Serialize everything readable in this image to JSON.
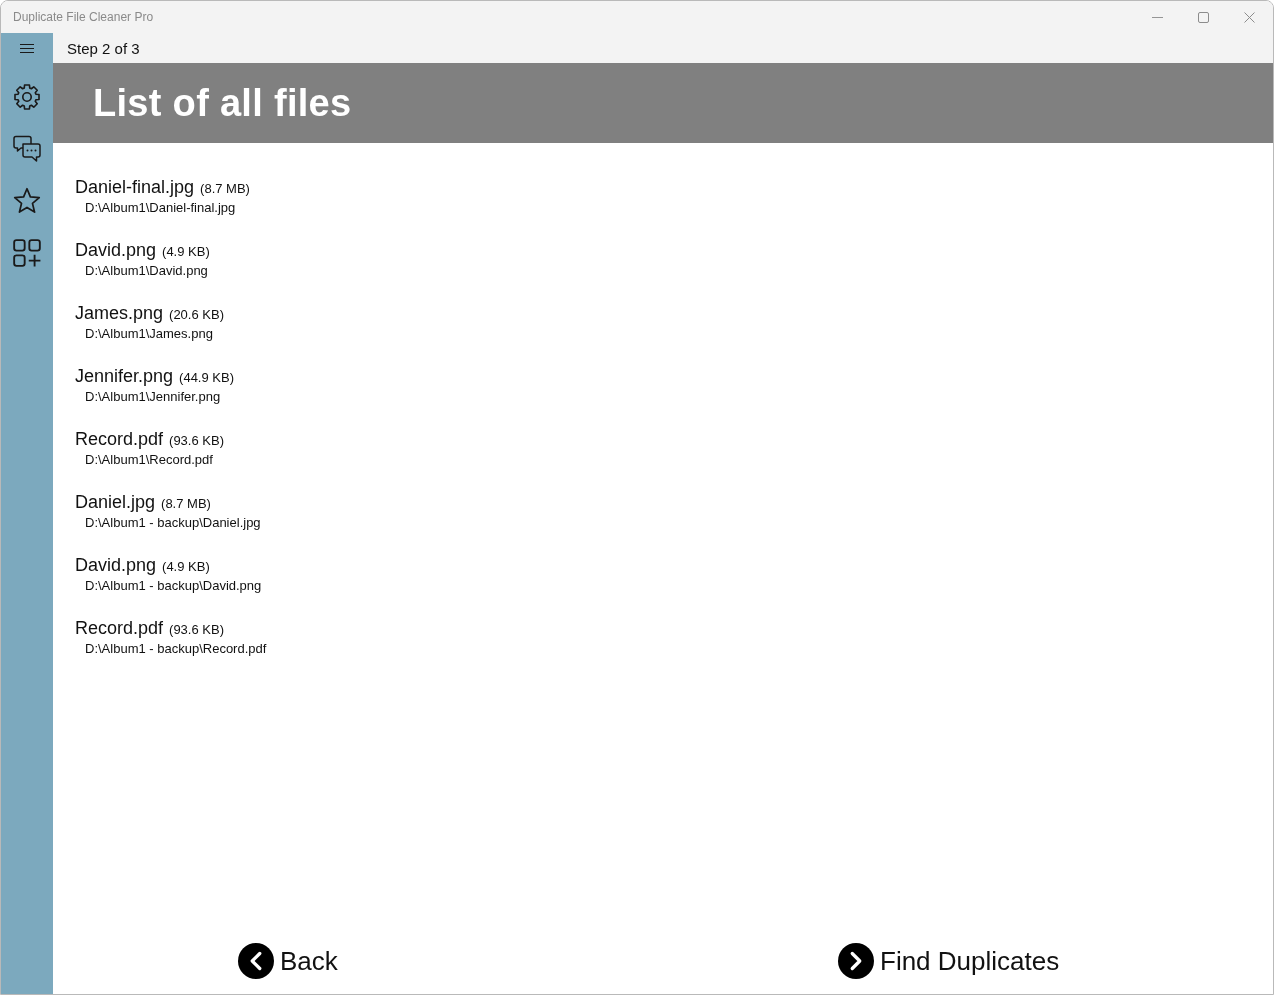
{
  "window": {
    "title": "Duplicate File Cleaner Pro"
  },
  "step": "Step 2 of 3",
  "header": {
    "title": "List of all files"
  },
  "files": [
    {
      "name": "Daniel-final.jpg",
      "size": "(8.7 MB)",
      "path": "D:\\Album1\\Daniel-final.jpg"
    },
    {
      "name": "David.png",
      "size": "(4.9 KB)",
      "path": "D:\\Album1\\David.png"
    },
    {
      "name": "James.png",
      "size": "(20.6 KB)",
      "path": "D:\\Album1\\James.png"
    },
    {
      "name": "Jennifer.png",
      "size": "(44.9 KB)",
      "path": "D:\\Album1\\Jennifer.png"
    },
    {
      "name": "Record.pdf",
      "size": "(93.6 KB)",
      "path": "D:\\Album1\\Record.pdf"
    },
    {
      "name": "Daniel.jpg",
      "size": "(8.7 MB)",
      "path": "D:\\Album1 - backup\\Daniel.jpg"
    },
    {
      "name": "David.png",
      "size": "(4.9 KB)",
      "path": "D:\\Album1 - backup\\David.png"
    },
    {
      "name": "Record.pdf",
      "size": "(93.6 KB)",
      "path": "D:\\Album1 - backup\\Record.pdf"
    }
  ],
  "buttons": [
    {
      "kind": "back",
      "label": "Back"
    },
    {
      "kind": "next",
      "label": "Find Duplicates"
    }
  ]
}
